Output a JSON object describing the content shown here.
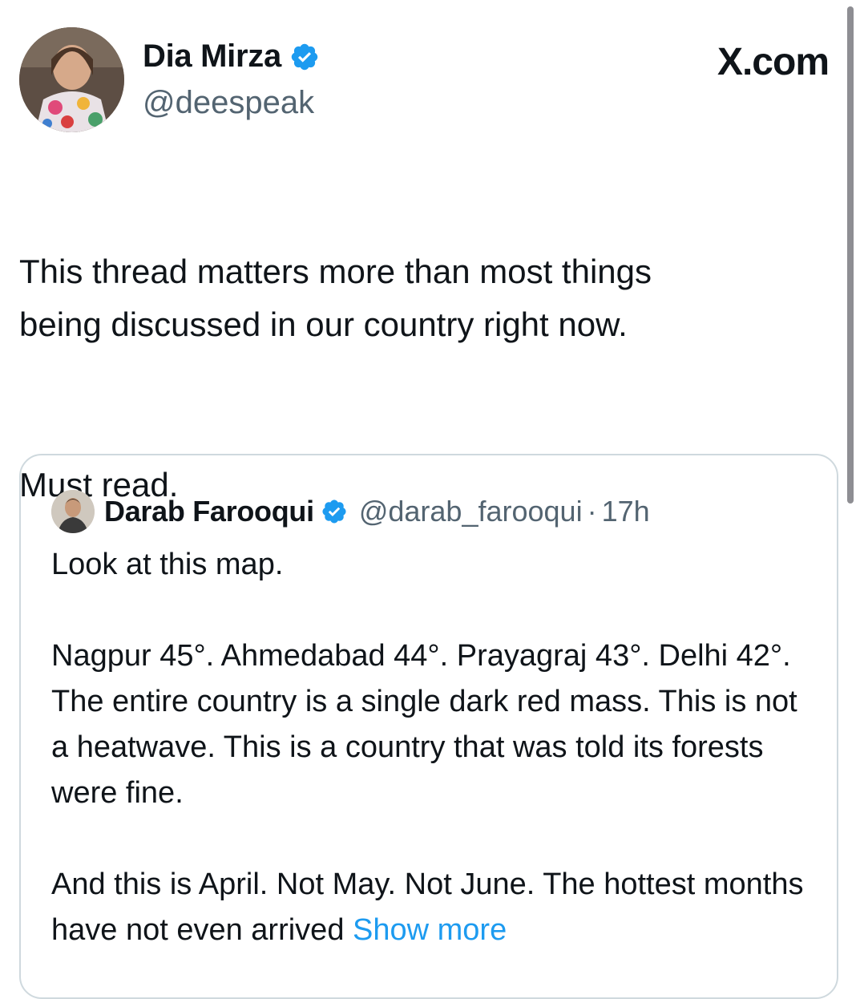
{
  "post": {
    "author_name": "Dia Mirza",
    "author_handle": "@deespeak",
    "brand": "X.com",
    "paragraphs": [
      "This thread matters more than most things\nbeing discussed in our country right now.",
      "Must read."
    ]
  },
  "quoted": {
    "author_name": "Darab Farooqui",
    "author_handle": "@darab_farooqui",
    "separator": "·",
    "time": "17h",
    "paragraphs": [
      "Look at this map.",
      "Nagpur 45°. Ahmedabad 44°. Prayagraj 43°. Delhi 42°. The entire country is a single dark red mass. This is not a heatwave. This is a country that was told its forests were fine."
    ],
    "last_paragraph": "And this is April. Not May. Not June. The hottest months have not even arrived",
    "show_more": "Show more"
  },
  "colors": {
    "verified": "#1d9bf0",
    "link": "#1d9bf0",
    "secondary_text": "#536471",
    "border": "#cfd9de"
  },
  "icons": {
    "verified": "verified-badge-icon"
  }
}
